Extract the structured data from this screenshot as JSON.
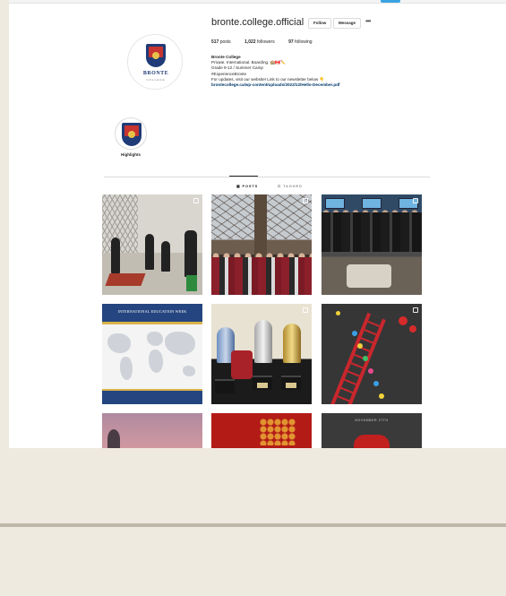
{
  "profile": {
    "username": "bronte.college.official",
    "follow_label": "Follow",
    "message_label": "Message",
    "more_label": "•••",
    "avatar_word": "BRONTE",
    "avatar_sub": "COLLEGE"
  },
  "stats": {
    "posts_count": "517",
    "posts_label": "posts",
    "followers_count": "1,022",
    "followers_label": "followers",
    "following_count": "97",
    "following_label": "following"
  },
  "bio": {
    "name": "Bronte College",
    "line1": "Private. International. Boarding. 🏫🇨🇦✏️",
    "line2": "Grade 9-12 / Summer Camp",
    "line3": "#ExperienceBronte",
    "line4": "For updates, visit our website! Link to our newsletter below 👇",
    "link": "brontecollege.ca/wp-content/uploads/2022/12/Hello-December.pdf"
  },
  "highlights": [
    {
      "label": "Highlights"
    }
  ],
  "tabs": {
    "posts_label": "▦ POSTS",
    "tagged_label": "⊡ TAGGED"
  },
  "posts": {
    "iew_title": "INTERNATIONAL EDUCATION WEEK",
    "p9_caption": "NOVEMBER 27TH"
  },
  "colors": {
    "link": "#00376b",
    "brand_navy": "#1f3b78",
    "brand_red": "#c8342f",
    "page_bg": "#efeadf"
  }
}
